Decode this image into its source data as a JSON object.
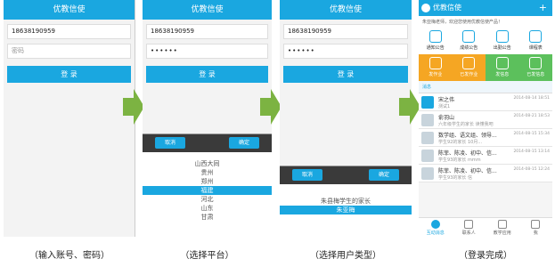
{
  "app_title": "优教信使",
  "login": {
    "account": "18638190959",
    "password_placeholder": "密码",
    "password_masked": "••••••",
    "login_label": "登 录"
  },
  "platform_picker": {
    "cancel": "取消",
    "confirm": "确定",
    "options": [
      "山西大同",
      "贵州",
      "郑州",
      "福建",
      "河北",
      "山东",
      "甘肃"
    ],
    "selected_index": 3
  },
  "usertype_picker": {
    "cancel": "取消",
    "confirm": "确定",
    "options": [
      "朱县梅学生的家长",
      "朱亚梅"
    ],
    "selected_index": 1
  },
  "home": {
    "title": "优教信使",
    "plus": "+",
    "welcome": "朱亚梅老师，欢迎您使用优教信使产品！",
    "grid": [
      {
        "label": "通知公告",
        "icon": "speaker-icon"
      },
      {
        "label": "成绩公告",
        "icon": "grade-icon"
      },
      {
        "label": "出勤公告",
        "icon": "clock-icon"
      },
      {
        "label": "课程表",
        "icon": "schedule-icon"
      },
      {
        "label": "发作业",
        "icon": "homework-icon"
      },
      {
        "label": "已发作业",
        "icon": "sent-homework-icon"
      },
      {
        "label": "发信息",
        "icon": "bell-icon"
      },
      {
        "label": "已发信息",
        "icon": "sent-bell-icon"
      }
    ],
    "messages_header": "消息",
    "messages": [
      {
        "name": "宋之伟",
        "sub": "测试1",
        "time": "2014-08-14 18:51"
      },
      {
        "name": "俞羽山",
        "sub": "六年级学生的家长 读懂我吧",
        "time": "2014-08-21 18:53"
      },
      {
        "name": "数学组、语文组、领导...",
        "sub": "学生92的家长 10月...",
        "time": "2014-08-15 15:34"
      },
      {
        "name": "陈菲、陈凌、初中、信...",
        "sub": "学生93的家长 mmm",
        "time": "2014-08-15 13:14"
      },
      {
        "name": "陈菲、陈凌、初中、信...",
        "sub": "学生93的家长 信",
        "time": "2014-08-15 12:24"
      }
    ],
    "tabs": [
      "互动消息",
      "联系人",
      "教学应用",
      "我"
    ]
  },
  "captions": [
    "（输入账号、密码）",
    "（选择平台）",
    "（选择用户类型）",
    "（登录完成）"
  ],
  "colors": {
    "accent": "#1aa7e0",
    "arrow": "#7cb342",
    "orange": "#f5a623",
    "green": "#5cc05c"
  }
}
